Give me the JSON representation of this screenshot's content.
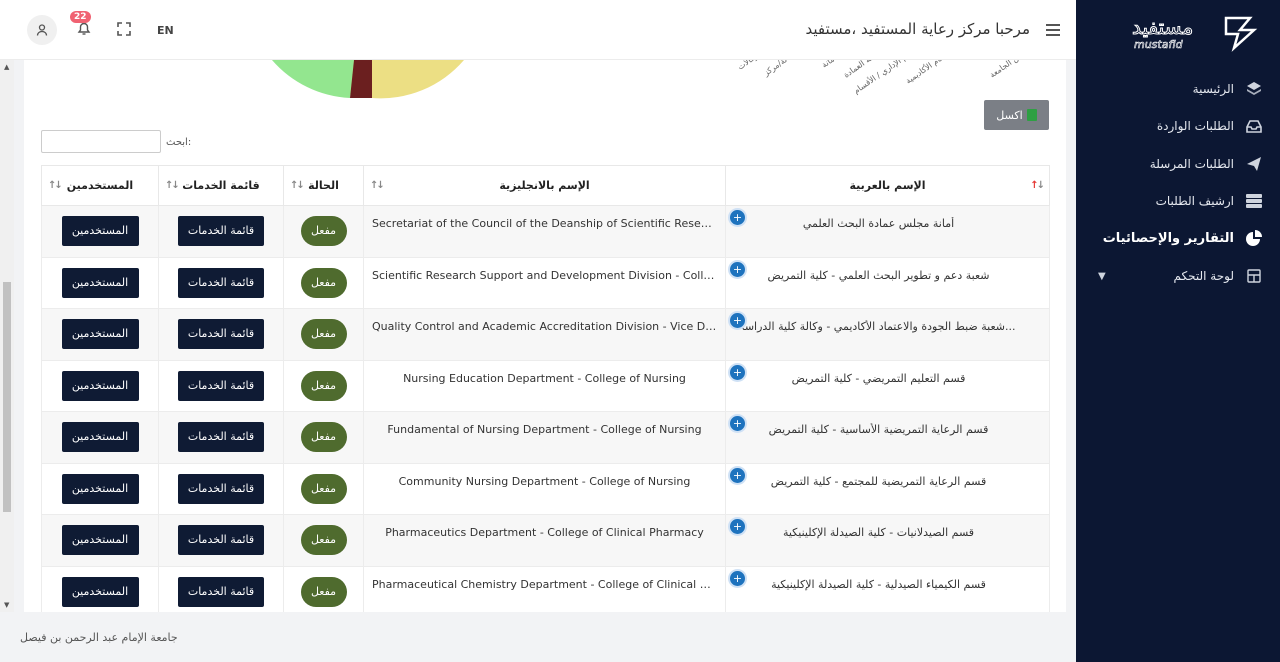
{
  "header": {
    "title": "مرحبا مركز رعاية المستفيد ،مستفيد",
    "language": "EN",
    "notifications_count": "22"
  },
  "sidebar": {
    "logo_text": "mustafid",
    "items": [
      {
        "label": "الرئيسية",
        "icon": "layers-icon"
      },
      {
        "label": "الطلبات الواردة",
        "icon": "inbox-icon"
      },
      {
        "label": "الطلبات المرسلة",
        "icon": "send-icon"
      },
      {
        "label": "ارشيف الطلبات",
        "icon": "archive-icon"
      },
      {
        "label": "التقارير والإحصائيات",
        "icon": "pie-chart-icon",
        "active": true
      },
      {
        "label": "لوحة التحكم",
        "icon": "dashboard-icon",
        "has_submenu": true
      }
    ]
  },
  "toolbar": {
    "excel_label": "اكسل",
    "search_label": "ابحث:",
    "search_value": ""
  },
  "table": {
    "headers": {
      "arabic_name": "الإسم بالعربية",
      "english_name": "الإسم بالانجليزية",
      "status": "الحالة",
      "services": "قائمة الخدمات",
      "users": "المستخدمين"
    },
    "status_label": "مفعل",
    "services_button": "قائمة الخدمات",
    "users_button": "المستخدمين",
    "rows": [
      {
        "ar": "أمانة مجلس عمادة البحث العلمي",
        "en": "Secretariat of the Council of the Deanship of Scientific Research"
      },
      {
        "ar": "شعبة دعم و تطوير البحث العلمي - كلية التمريض",
        "en": "Scientific Research Support and Development Division - College o..."
      },
      {
        "ar": "شعبة ضبط الجودة والاعتماد الأكاديمي - وكالة كلية الدراسا...",
        "en": "Quality Control and Academic Accreditation Division - Vice Dean..."
      },
      {
        "ar": "قسم التعليم التمريضي - كلية التمريض",
        "en": "Nursing Education Department - College of Nursing"
      },
      {
        "ar": "قسم الرعاية التمريضية الأساسية - كلية التمريض",
        "en": "Fundamental of Nursing Department - College of Nursing"
      },
      {
        "ar": "قسم الرعاية التمريضية للمجتمع - كلية التمريض",
        "en": "Community Nursing Department - College of Nursing"
      },
      {
        "ar": "قسم الصيدلانيات - كلية الصيدلة الإكلينيكية",
        "en": "Pharmaceutics Department - College of Clinical Pharmacy"
      },
      {
        "ar": "قسم الكيمياء الصيدلية - كلية الصيدلة الإكلينيكية",
        "en": "Pharmaceutical Chemistry Department - College of Clinical Phar..."
      }
    ]
  },
  "footer": {
    "text": "جامعة الإمام عبد الرحمن بن فيصل"
  },
  "colors": {
    "sidebar_bg": "#0c1733",
    "status_green": "#4f6b2e",
    "dark_button": "#0f1b34",
    "plus_blue": "#1e73be",
    "badge_red": "#f06272"
  }
}
